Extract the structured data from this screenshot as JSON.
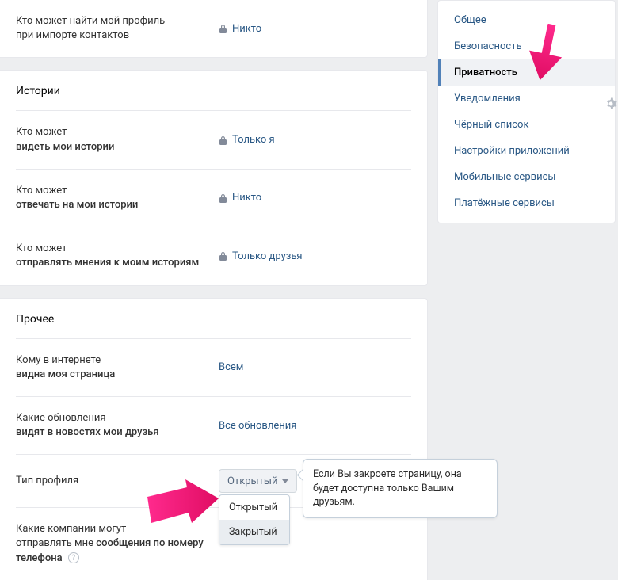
{
  "mainTop": {
    "rows": [
      {
        "l1": "Кто может найти мой профиль",
        "l2": "при импорте контактов",
        "bold_l2": false,
        "value": "Никто",
        "locked": true
      }
    ]
  },
  "stories": {
    "header": "Истории",
    "rows": [
      {
        "l1": "Кто может",
        "l2": "видеть мои истории",
        "bold_l2": true,
        "value": "Только я",
        "locked": true
      },
      {
        "l1": "Кто может",
        "l2": "отвечать на мои истории",
        "bold_l2": true,
        "value": "Никто",
        "locked": true
      },
      {
        "l1": "Кто может",
        "l2": "отправлять мнения к моим историям",
        "bold_l2": true,
        "value": "Только друзья",
        "locked": true
      }
    ]
  },
  "other": {
    "header": "Прочее",
    "rows": [
      {
        "l1": "Кому в интернете",
        "l2": "видна моя страница",
        "bold_l2": true,
        "value": "Всем",
        "locked": false
      },
      {
        "l1": "Какие обновления",
        "l2": "видят в новостях мои друзья",
        "bold_l2": true,
        "value": "Все обновления",
        "locked": false
      }
    ],
    "profileType": {
      "label": "Тип профиля",
      "selected": "Открытый",
      "options": [
        "Открытый",
        "Закрытый"
      ],
      "tooltip": "Если Вы закроете страницу, она будет доступна только Вашим друзьям."
    },
    "companyMessages": {
      "l1": "Какие компании могут",
      "l2_a": "отправлять мне ",
      "l2_b": "сообщения по номеру телефона",
      "help": "?"
    }
  },
  "sidebar": {
    "items": [
      {
        "label": "Общее",
        "active": false
      },
      {
        "label": "Безопасность",
        "active": false
      },
      {
        "label": "Приватность",
        "active": true
      },
      {
        "label": "Уведомления",
        "active": false
      },
      {
        "label": "Чёрный список",
        "active": false
      },
      {
        "label": "Настройки приложений",
        "active": false
      },
      {
        "label": "Мобильные сервисы",
        "active": false
      },
      {
        "label": "Платёжные сервисы",
        "active": false
      }
    ]
  }
}
